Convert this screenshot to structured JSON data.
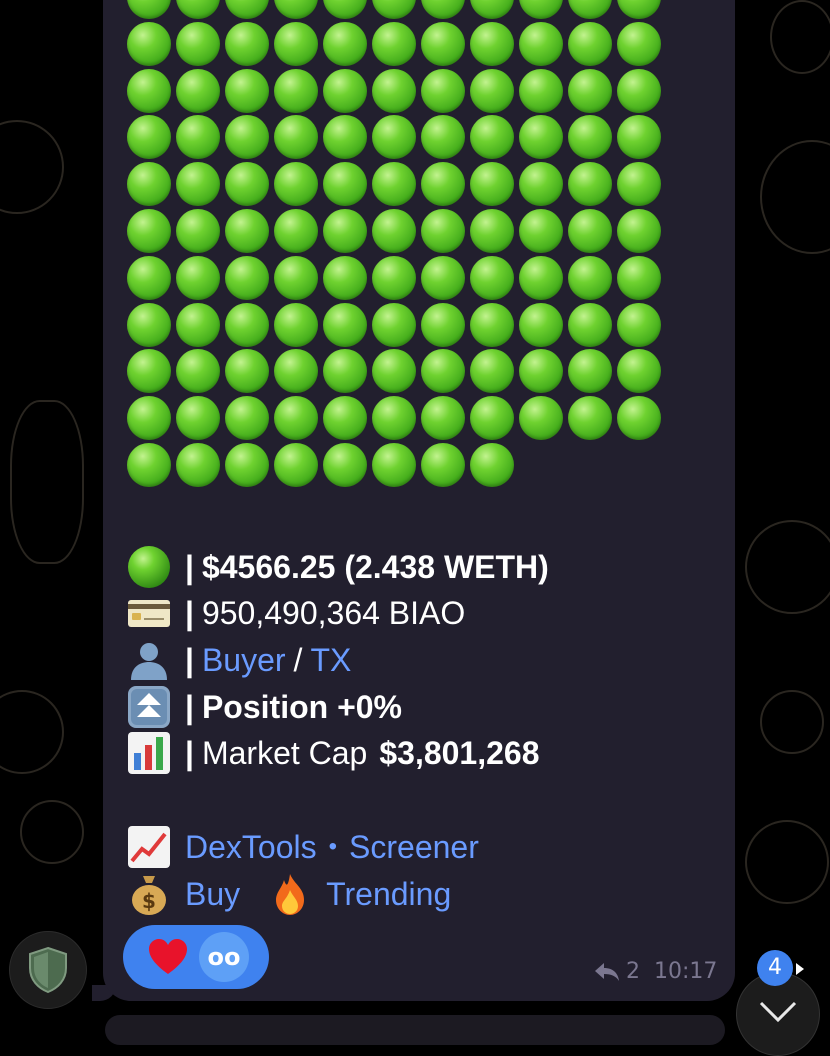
{
  "message": {
    "dot_count": 118,
    "stats": {
      "price_label": "$4566.25 (2.438 WETH)",
      "amount_label": "950,490,364 BIAO",
      "buyer_link": "Buyer",
      "slash": "/",
      "tx_link": "TX",
      "position_label": "Position +0%",
      "market_cap_label": "Market Cap",
      "market_cap_value": "$3,801,268",
      "separator": "|"
    },
    "links": {
      "dextools": "DexTools",
      "bullet": "•",
      "screener": "Screener",
      "buy": "Buy",
      "trending": "Trending"
    },
    "icons": {
      "price": "green-circle-icon",
      "amount": "credit-card-icon",
      "buyer": "bust-silhouette-icon",
      "position": "fast-up-button-icon",
      "market_cap": "bar-chart-icon",
      "dextools": "chart-increasing-icon",
      "buy": "money-bag-icon",
      "trending": "fire-icon"
    },
    "reactions": {
      "heart": "red-heart-icon",
      "avatar_text": "oo"
    },
    "replies_count": "2",
    "time": "10:17"
  },
  "unread_badge": "4",
  "colors": {
    "bubble": "#221f2e",
    "link": "#6a9bff",
    "accent": "#3f82ef",
    "dot_green": "#52c41a"
  }
}
